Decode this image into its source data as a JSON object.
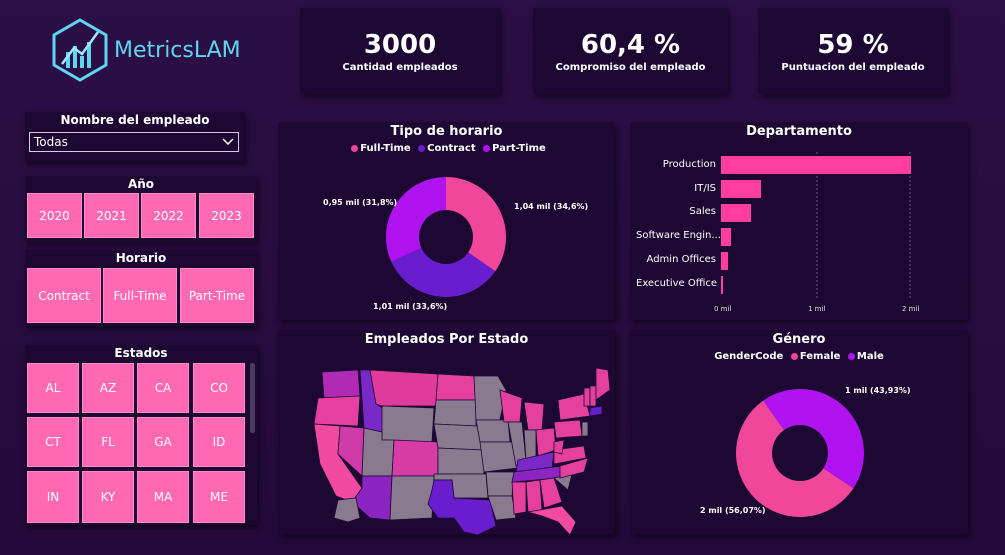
{
  "brand": {
    "name": "MetricsLAM"
  },
  "kpis": [
    {
      "value": "3000",
      "label": "Cantidad empleados"
    },
    {
      "value": "60,4 %",
      "label": "Compromiso del empleado"
    },
    {
      "value": "59 %",
      "label": "Puntuacion del empleado"
    }
  ],
  "employee_filter": {
    "title": "Nombre del empleado",
    "selected": "Todas"
  },
  "year_filter": {
    "title": "Año",
    "options": [
      "2020",
      "2021",
      "2022",
      "2023"
    ]
  },
  "schedule_filter": {
    "title": "Horario",
    "options": [
      "Contract",
      "Full-Time",
      "Part-Time"
    ]
  },
  "states_filter": {
    "title": "Estados",
    "options": [
      "AL",
      "AZ",
      "CA",
      "CO",
      "CT",
      "FL",
      "GA",
      "ID",
      "IN",
      "KY",
      "MA",
      "ME"
    ]
  },
  "schedule_chart": {
    "title": "Tipo de horario",
    "legend": [
      "Full-Time",
      "Contract",
      "Part-Time"
    ],
    "labels": [
      "1,04 mil (34,6%)",
      "1,01 mil (33,6%)",
      "0,95 mil (31,8%)"
    ],
    "colors": {
      "full_time": "#f0479a",
      "contract": "#6a1ccf",
      "part_time": "#b012f0"
    }
  },
  "dept_chart": {
    "title": "Departamento",
    "categories": [
      "Production",
      "IT/IS",
      "Sales",
      "Software Engin...",
      "Admin Offices",
      "Executive Office"
    ],
    "ticks": [
      "0 mil",
      "1 mil",
      "2 mil"
    ],
    "color": "#ff3ea0"
  },
  "map": {
    "title": "Empleados Por Estado"
  },
  "gender_chart": {
    "title": "Género",
    "legend_title": "GenderCode",
    "legend": [
      "Female",
      "Male"
    ],
    "labels": [
      "1 mil (43,93%)",
      "2 mil (56,07%)"
    ],
    "colors": {
      "female": "#f0479a",
      "male": "#b012f0"
    }
  },
  "chart_data": [
    {
      "type": "pie",
      "title": "Tipo de horario",
      "categories": [
        "Full-Time",
        "Contract",
        "Part-Time"
      ],
      "values": [
        1040,
        1010,
        950
      ]
    },
    {
      "type": "bar",
      "title": "Departamento",
      "categories": [
        "Production",
        "IT/IS",
        "Sales",
        "Software Engin...",
        "Admin Offices",
        "Executive Office"
      ],
      "values": [
        2000,
        420,
        320,
        110,
        70,
        15
      ],
      "xlim": [
        0,
        2000
      ]
    },
    {
      "type": "pie",
      "title": "Género",
      "categories": [
        "Female",
        "Male"
      ],
      "values": [
        1680,
        1320
      ]
    }
  ]
}
